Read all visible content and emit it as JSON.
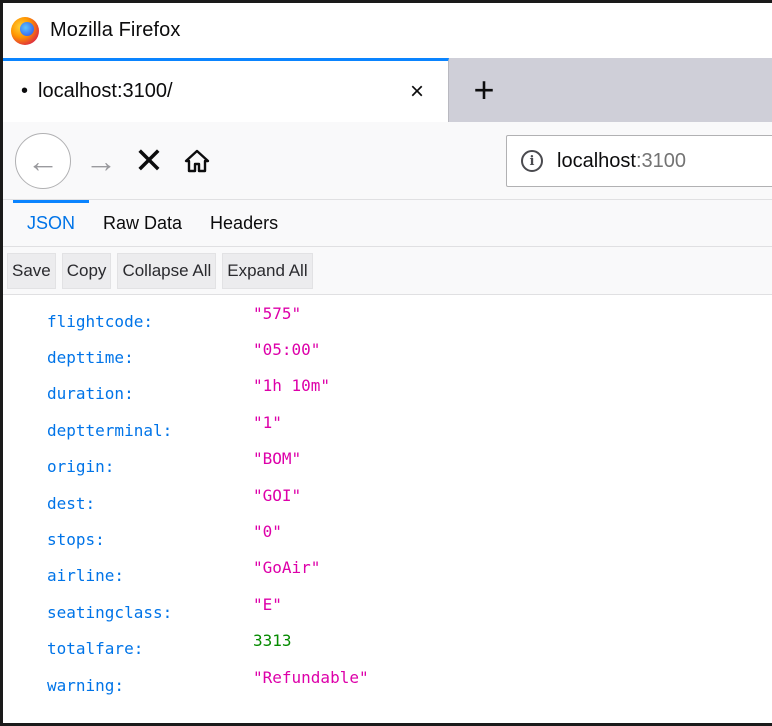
{
  "window": {
    "title": "Mozilla Firefox"
  },
  "tab": {
    "bullet": "•",
    "label": "localhost:3100/",
    "close": "×"
  },
  "newtab": {
    "label": "+"
  },
  "nav": {
    "back": "←",
    "forward": "→",
    "stop": "✕",
    "url_host": "localhost",
    "url_port": ":3100",
    "info": "i"
  },
  "viewer_tabs": [
    {
      "label": "JSON",
      "active": true
    },
    {
      "label": "Raw Data",
      "active": false
    },
    {
      "label": "Headers",
      "active": false
    }
  ],
  "toolbar": {
    "save": "Save",
    "copy": "Copy",
    "collapse": "Collapse All",
    "expand": "Expand All"
  },
  "json": [
    {
      "key": "flightcode:",
      "value": "\"575\"",
      "type": "string"
    },
    {
      "key": "depttime:",
      "value": "\"05:00\"",
      "type": "string"
    },
    {
      "key": "duration:",
      "value": "\"1h 10m\"",
      "type": "string"
    },
    {
      "key": "deptterminal:",
      "value": "\"1\"",
      "type": "string"
    },
    {
      "key": "origin:",
      "value": "\"BOM\"",
      "type": "string"
    },
    {
      "key": "dest:",
      "value": "\"GOI\"",
      "type": "string"
    },
    {
      "key": "stops:",
      "value": "\"0\"",
      "type": "string"
    },
    {
      "key": "airline:",
      "value": "\"GoAir\"",
      "type": "string"
    },
    {
      "key": "seatingclass:",
      "value": "\"E\"",
      "type": "string"
    },
    {
      "key": "totalfare:",
      "value": "3313",
      "type": "number"
    },
    {
      "key": "warning:",
      "value": "\"Refundable\"",
      "type": "string"
    }
  ],
  "colors": {
    "accent": "#0a84ff",
    "json_key": "#0074e8",
    "json_string": "#dd00a9",
    "json_number": "#058b00"
  },
  "icons": {
    "app": "firefox-logo-icon",
    "back": "back-arrow-icon",
    "forward": "forward-arrow-icon",
    "stop": "stop-icon",
    "home": "home-icon",
    "info": "info-icon",
    "close": "close-icon",
    "new_tab": "plus-icon"
  }
}
